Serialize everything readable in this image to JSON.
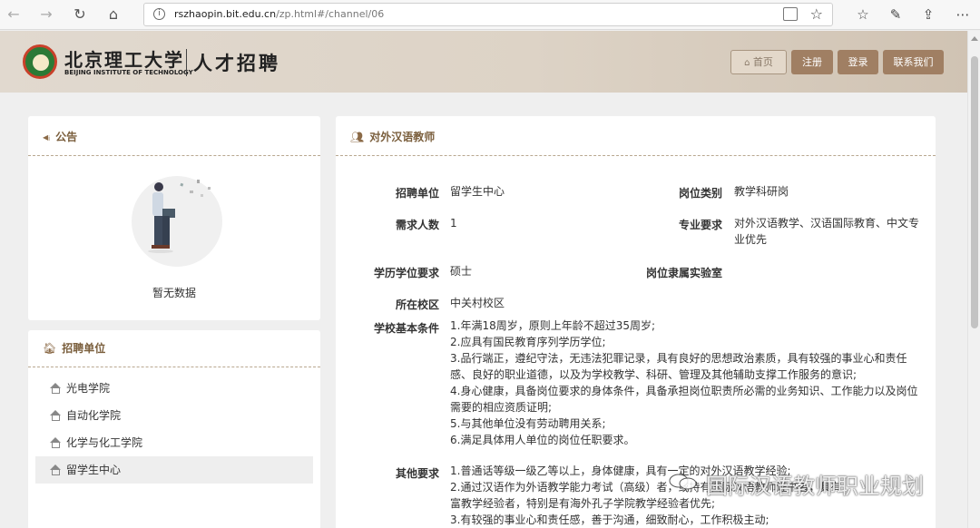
{
  "browser": {
    "url_host": "rszhaopin.bit.edu.cn",
    "url_path": "/zp.html#/channel/06"
  },
  "header": {
    "school_cn": "北京理工大学",
    "school_en": "BEIJING INSTITUTE OF TECHNOLOGY",
    "site_name": "人才招聘",
    "nav": {
      "home": "首页",
      "register": "注册",
      "login": "登录",
      "contact": "联系我们"
    }
  },
  "announcement": {
    "title": "公告",
    "empty_text": "暂无数据"
  },
  "units": {
    "title": "招聘单位",
    "items": [
      "光电学院",
      "自动化学院",
      "化学与化工学院",
      "留学生中心"
    ],
    "active_index": 3
  },
  "job": {
    "title": "对外汉语教师",
    "labels": {
      "unit": "招聘单位",
      "category": "岗位类别",
      "count": "需求人数",
      "major": "专业要求",
      "degree": "学历学位要求",
      "lab": "岗位隶属实验室",
      "campus": "所在校区",
      "basic": "学校基本条件",
      "other": "其他要求"
    },
    "values": {
      "unit": "留学生中心",
      "category": "教学科研岗",
      "count": "1",
      "major": "对外汉语教学、汉语国际教育、中文专业优先",
      "degree": "硕士",
      "lab": "",
      "campus": "中关村校区"
    },
    "basic_conditions": [
      "1.年满18周岁，原则上年龄不超过35周岁;",
      "2.应具有国民教育序列学历学位;",
      "3.品行端正，遵纪守法，无违法犯罪记录，具有良好的思想政治素质，具有较强的事业心和责任",
      "感、良好的职业道德，以及为学校教学、科研、管理及其他辅助支撑工作服务的意识;",
      "4.身心健康，具备岗位要求的身体条件，具备承担岗位职责所必需的业务知识、工作能力以及岗位",
      "需要的相应资质证明;",
      "5.与其他单位没有劳动聘用关系;",
      "6.满足具体用人单位的岗位任职要求。"
    ],
    "other_requirements": [
      "1.普通话等级一级乙等以上，身体健康，具有一定的对外汉语教学经验;",
      "2.通过汉语作为外语教学能力考试（高级）者，或持有国际汉语教师证书者，具有",
      "富教学经验者，特别是有海外孔子学院教学经验者优先;",
      "3.有较强的事业心和责任感，善于沟通，细致耐心，工作积极主动;"
    ]
  },
  "watermark": {
    "text": "国际汉语教师职业规划"
  }
}
